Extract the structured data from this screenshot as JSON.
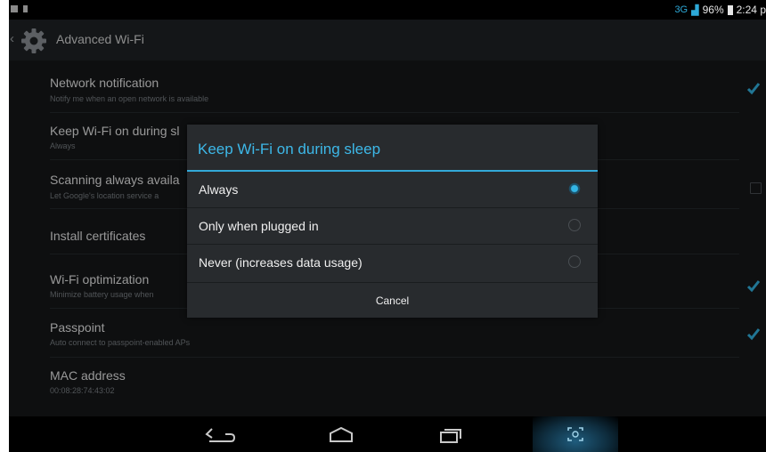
{
  "status_bar": {
    "network_label": "3G",
    "battery_label": "96%",
    "time": "2:24 p"
  },
  "action_bar": {
    "title": "Advanced Wi-Fi",
    "icon": "gear-icon"
  },
  "settings": [
    {
      "title": "Network notification",
      "subtitle": "Notify me when an open network is available",
      "checked": true
    },
    {
      "title": "Keep Wi-Fi on during sl",
      "subtitle": "Always"
    },
    {
      "title": "Scanning always availa",
      "subtitle": "Let Google's location service a",
      "checked": false
    },
    {
      "title": "Install certificates",
      "subtitle": ""
    },
    {
      "title": "Wi-Fi optimization",
      "subtitle": "Minimize battery usage when",
      "checked": true
    },
    {
      "title": "Passpoint",
      "subtitle": "Auto connect to passpoint-enabled APs",
      "checked": true
    },
    {
      "title": "MAC address",
      "subtitle": "00:08:28:74:43:02"
    }
  ],
  "dialog": {
    "title": "Keep Wi-Fi on during sleep",
    "options": [
      {
        "label": "Always",
        "selected": true
      },
      {
        "label": "Only when plugged in",
        "selected": false
      },
      {
        "label": "Never (increases data usage)",
        "selected": false
      }
    ],
    "cancel_label": "Cancel"
  },
  "nav_bar": {
    "buttons": [
      "back-icon",
      "home-icon",
      "recent-apps-icon",
      "screenshot-icon"
    ]
  },
  "colors": {
    "accent": "#33b5e5",
    "background": "#16181a",
    "dialog_background": "#282b2e"
  }
}
